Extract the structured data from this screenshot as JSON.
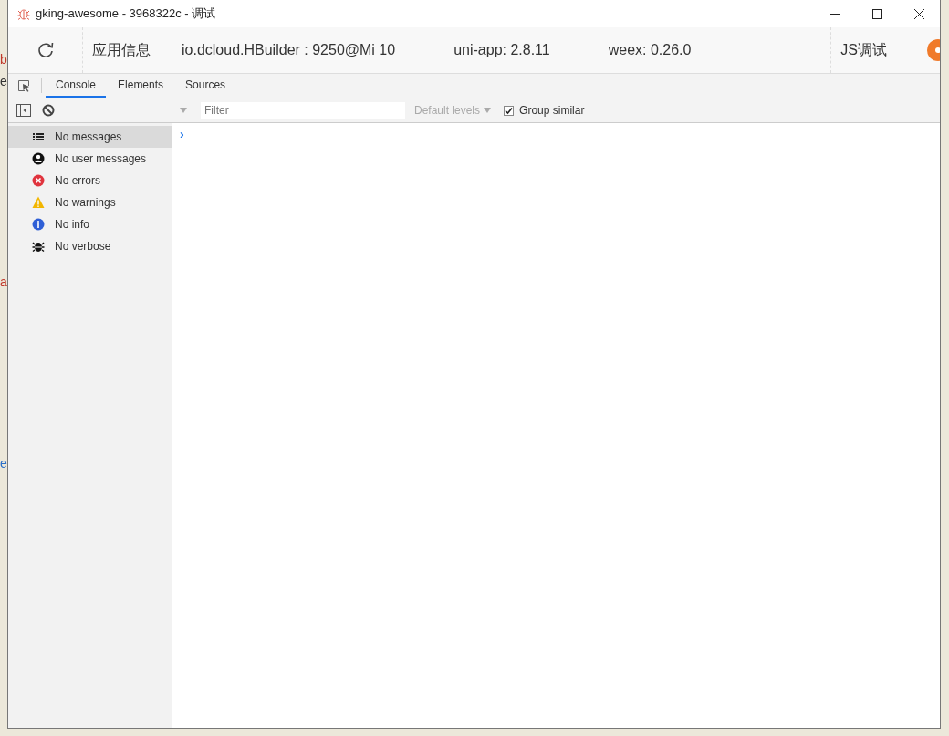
{
  "background_window": {
    "letters": [
      {
        "text": "b",
        "color": "#c0392b"
      },
      {
        "text": "e",
        "color": "#333333"
      },
      {
        "text": "a",
        "color": "#c0392b"
      },
      {
        "text": "e",
        "color": "#2a6fc9"
      }
    ]
  },
  "window": {
    "title": "gking-awesome - 3968322c - 调试"
  },
  "toolbar": {
    "app_info_label": "应用信息",
    "package": "io.dcloud.HBuilder : 9250@Mi 10",
    "uni_app": "uni-app: 2.8.11",
    "weex": "weex: 0.26.0",
    "js_debug": "JS调试"
  },
  "tabs": [
    {
      "label": "Console",
      "selected": true
    },
    {
      "label": "Elements",
      "selected": false
    },
    {
      "label": "Sources",
      "selected": false
    }
  ],
  "filter_bar": {
    "placeholder": "Filter",
    "levels": "Default levels",
    "group_similar": {
      "label": "Group similar",
      "checked": true
    }
  },
  "sidebar": {
    "items": [
      {
        "kind": "list",
        "label": "No messages",
        "selected": true
      },
      {
        "kind": "user",
        "label": "No user messages",
        "selected": false
      },
      {
        "kind": "error",
        "label": "No errors",
        "selected": false
      },
      {
        "kind": "warning",
        "label": "No warnings",
        "selected": false
      },
      {
        "kind": "info",
        "label": "No info",
        "selected": false
      },
      {
        "kind": "verbose",
        "label": "No verbose",
        "selected": false
      }
    ]
  },
  "console": {
    "prompt": "›"
  }
}
